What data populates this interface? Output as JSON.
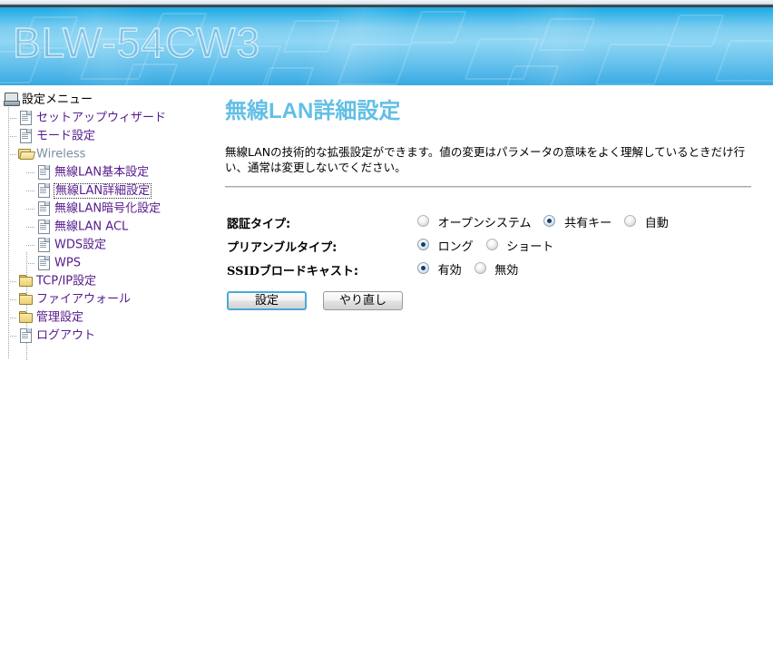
{
  "banner": {
    "title": "BLW-54CW3",
    "watermark_icon": "monitor-watermark"
  },
  "sidebar": {
    "root": {
      "label": "設定メニュー",
      "icon": "computer-icon",
      "level": 0,
      "style": "plain-black"
    },
    "items": [
      {
        "label": "セットアップウィザード",
        "icon": "page-icon",
        "level": 1,
        "style": "link-visited",
        "selected": false
      },
      {
        "label": "モード設定",
        "icon": "page-icon",
        "level": 1,
        "style": "link-visited",
        "selected": false
      },
      {
        "label": "Wireless",
        "icon": "folder-open-icon",
        "level": 1,
        "style": "link-gray",
        "selected": false
      },
      {
        "label": "無線LAN基本設定",
        "icon": "page-icon",
        "level": 2,
        "style": "link-visited",
        "selected": false
      },
      {
        "label": "無線LAN詳細設定",
        "icon": "page-icon",
        "level": 2,
        "style": "link-visited",
        "selected": true
      },
      {
        "label": "無線LAN暗号化設定",
        "icon": "page-icon",
        "level": 2,
        "style": "link-visited",
        "selected": false
      },
      {
        "label": "無線LAN ACL",
        "icon": "page-icon",
        "level": 2,
        "style": "link-visited",
        "selected": false
      },
      {
        "label": "WDS設定",
        "icon": "page-icon",
        "level": 2,
        "style": "link-visited",
        "selected": false
      },
      {
        "label": "WPS",
        "icon": "page-icon",
        "level": 2,
        "style": "link-visited",
        "selected": false
      },
      {
        "label": "TCP/IP設定",
        "icon": "folder-icon",
        "level": 1,
        "style": "link-visited",
        "selected": false
      },
      {
        "label": "ファイアウォール",
        "icon": "folder-icon",
        "level": 1,
        "style": "link-visited",
        "selected": false
      },
      {
        "label": "管理設定",
        "icon": "folder-icon",
        "level": 1,
        "style": "link-visited",
        "selected": false
      },
      {
        "label": "ログアウト",
        "icon": "page-icon",
        "level": 1,
        "style": "link-visited",
        "selected": false
      }
    ]
  },
  "main": {
    "title": "無線LAN詳細設定",
    "description": "無線LANの技術的な拡張設定ができます。値の変更はパラメータの意味をよく理解しているときだけ行い、通常は変更しないでください。",
    "rows": [
      {
        "label": "認証タイプ:",
        "label_plain": "認証タイプ:",
        "options": [
          {
            "label": "オープンシステム",
            "selected": false
          },
          {
            "label": "共有キー",
            "selected": true
          },
          {
            "label": "自動",
            "selected": false
          }
        ]
      },
      {
        "label": "プリアンブルタイプ:",
        "label_plain": "プリアンブルタイプ:",
        "options": [
          {
            "label": "ロング",
            "selected": true
          },
          {
            "label": "ショート",
            "selected": false
          }
        ]
      },
      {
        "label": "SSIDブロードキャスト:",
        "label_serif_prefix": "SSID",
        "label_rest": "ブロードキャスト:",
        "options": [
          {
            "label": "有効",
            "selected": true
          },
          {
            "label": "無効",
            "selected": false
          }
        ]
      }
    ],
    "buttons": {
      "submit": "設定",
      "reset": "やり直し"
    }
  },
  "colors": {
    "title": "#62bfe5",
    "banner_top": "#1fa6e0",
    "banner_mid": "#8fd6f4",
    "visited_link": "#551a8b",
    "gray_link": "#7b8ea0",
    "radio_dot": "#12406e",
    "focus_border": "#4aa8d8",
    "rule": "#a9a9a9"
  }
}
